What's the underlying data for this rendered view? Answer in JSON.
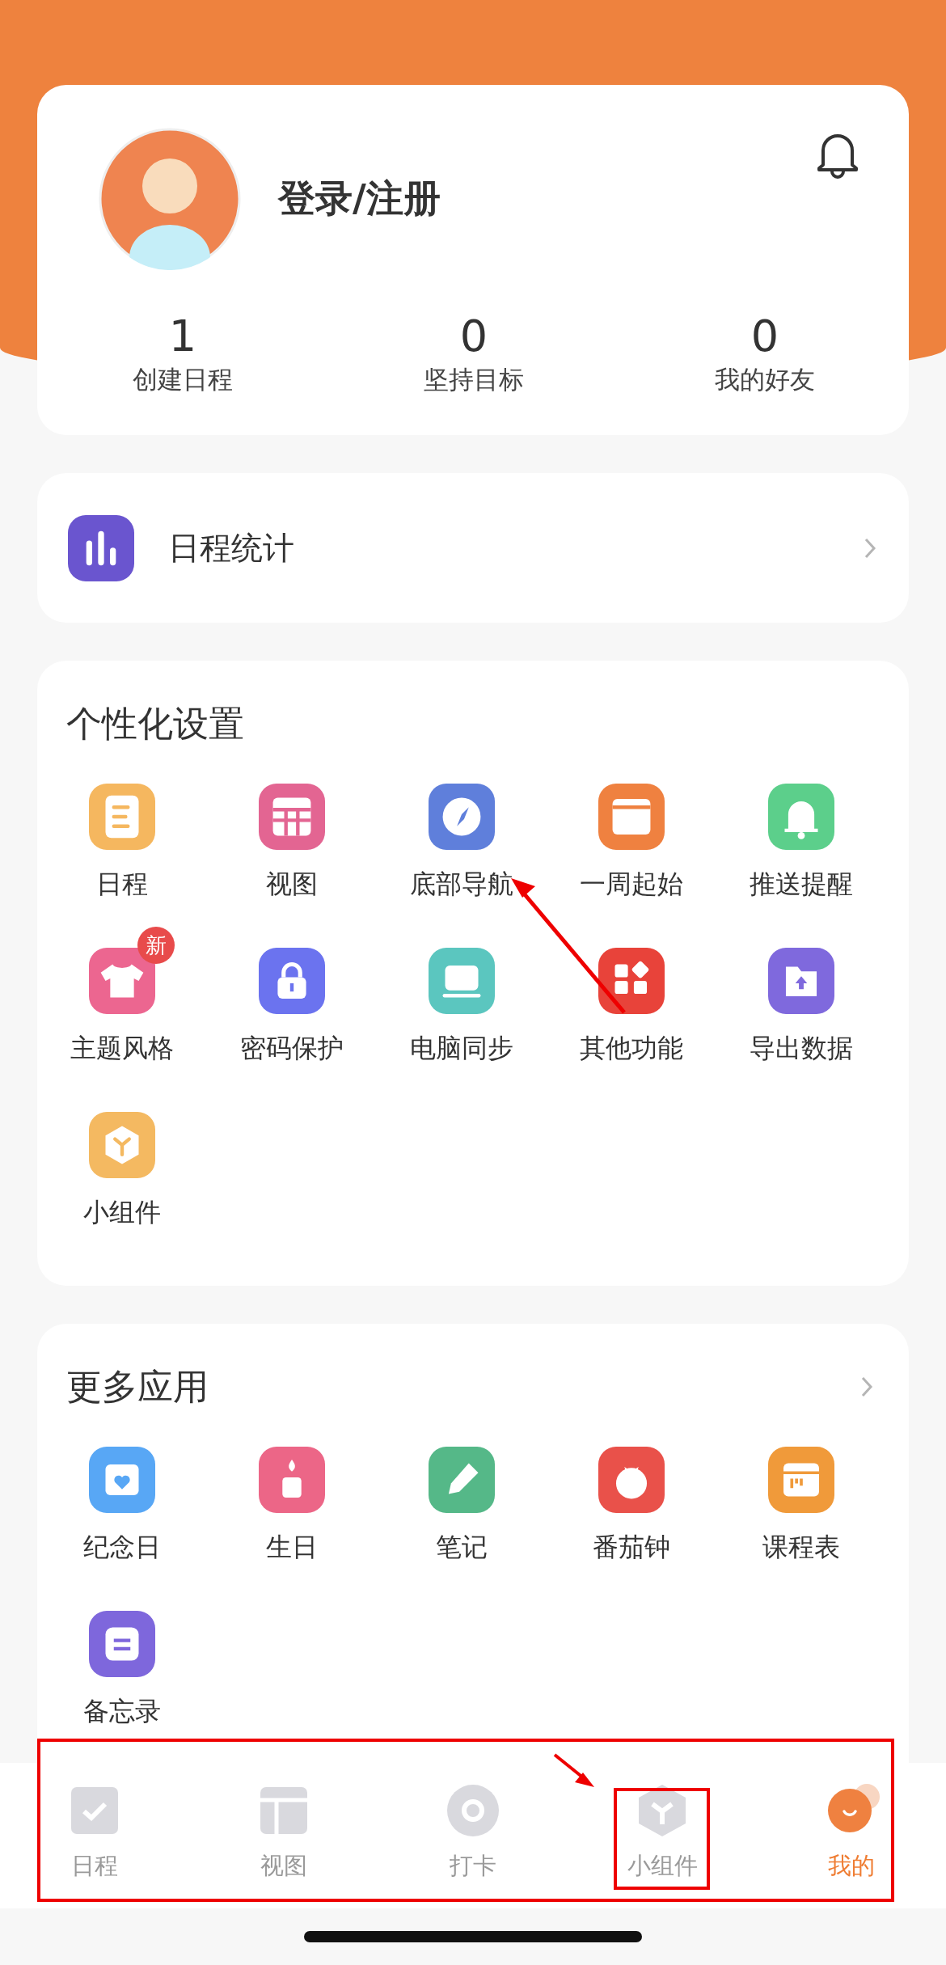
{
  "profile": {
    "title": "登录/注册",
    "stats": [
      {
        "value": "1",
        "label": "创建日程"
      },
      {
        "value": "0",
        "label": "坚持目标"
      },
      {
        "value": "0",
        "label": "我的好友"
      }
    ]
  },
  "stats_entry": {
    "label": "日程统计"
  },
  "personalization": {
    "title": "个性化设置",
    "items": [
      {
        "label": "日程",
        "color": "#f5b75f"
      },
      {
        "label": "视图",
        "color": "#e36592"
      },
      {
        "label": "底部导航",
        "color": "#5f7fdb"
      },
      {
        "label": "一周起始",
        "color": "#ef8140"
      },
      {
        "label": "推送提醒",
        "color": "#5ccf8b"
      },
      {
        "label": "主题风格",
        "color": "#ec6690",
        "badge": "新"
      },
      {
        "label": "密码保护",
        "color": "#6b73ef"
      },
      {
        "label": "电脑同步",
        "color": "#5bc6bf"
      },
      {
        "label": "其他功能",
        "color": "#e8433a"
      },
      {
        "label": "导出数据",
        "color": "#7f69dd"
      },
      {
        "label": "小组件",
        "color": "#f4b961"
      }
    ]
  },
  "more_apps": {
    "title": "更多应用",
    "items": [
      {
        "label": "纪念日",
        "color": "#58a7f5"
      },
      {
        "label": "生日",
        "color": "#ec6687"
      },
      {
        "label": "笔记",
        "color": "#55b888"
      },
      {
        "label": "番茄钟",
        "color": "#e9514a"
      },
      {
        "label": "课程表",
        "color": "#f09a3a"
      },
      {
        "label": "备忘录",
        "color": "#7e67dc"
      }
    ]
  },
  "tab_bar": [
    {
      "label": "日程",
      "selected": false
    },
    {
      "label": "视图",
      "selected": false
    },
    {
      "label": "打卡",
      "selected": false
    },
    {
      "label": "小组件",
      "selected": false
    },
    {
      "label": "我的",
      "selected": true
    }
  ]
}
